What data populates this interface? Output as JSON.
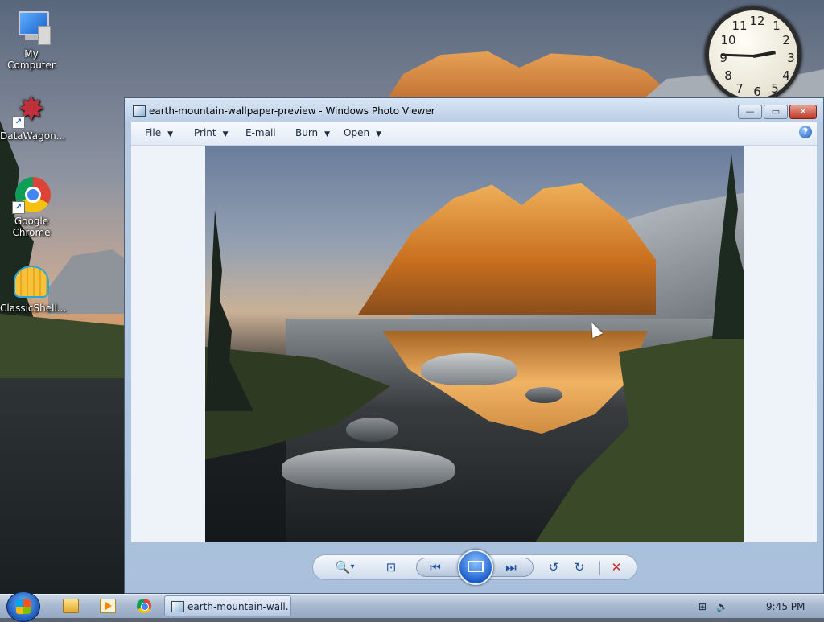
{
  "desktop": {
    "icons": [
      {
        "label": "My Computer",
        "icon": "computer-icon"
      },
      {
        "label": "DataWagon...",
        "icon": "datawagon-icon"
      },
      {
        "label": "Google Chrome",
        "icon": "chrome-icon"
      },
      {
        "label": "ClassicShell...",
        "icon": "classicshell-icon"
      }
    ]
  },
  "clock": {
    "numbers": [
      "12",
      "1",
      "2",
      "3",
      "4",
      "5",
      "6",
      "7",
      "8",
      "9",
      "10",
      "11"
    ]
  },
  "window": {
    "title": "earth-mountain-wallpaper-preview - Windows Photo Viewer",
    "buttons": {
      "minimize": "—",
      "maximize": "▭",
      "close": "✕"
    },
    "menu": [
      {
        "label": "File",
        "has_caret": true
      },
      {
        "label": "Print",
        "has_caret": true
      },
      {
        "label": "E-mail",
        "has_caret": false
      },
      {
        "label": "Burn",
        "has_caret": true
      },
      {
        "label": "Open",
        "has_caret": true
      }
    ],
    "help_label": "?",
    "controls": {
      "zoom": "🔍",
      "zoom_caret": "▾",
      "actual_size": "⊡",
      "previous": "⏮",
      "next": "⏭",
      "rotate_ccw": "↺",
      "rotate_cw": "↻",
      "delete": "✕"
    }
  },
  "taskbar": {
    "active_task": "earth-mountain-wall...",
    "time": "9:45 PM",
    "tray_icons": [
      "network-icon",
      "volume-icon"
    ]
  }
}
